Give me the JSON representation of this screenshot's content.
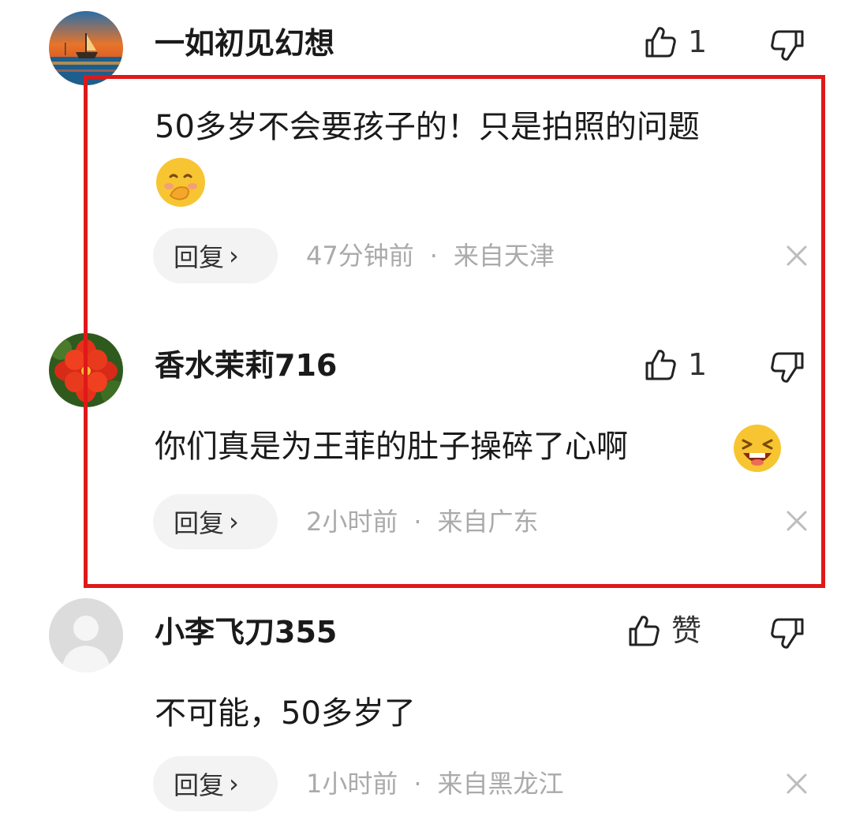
{
  "comments": [
    {
      "username": "一如初见幻想",
      "like_count": "1",
      "text": "50多岁不会要孩子的！只是拍照的问题",
      "reply_label": "回复",
      "time": "47分钟前",
      "location": "来自天津",
      "avatar_icon": "sunset-boat-painting-avatar"
    },
    {
      "username": "香水茉莉716",
      "like_count": "1",
      "text": "你们真是为王菲的肚子操碎了心啊",
      "reply_label": "回复",
      "time": "2小时前",
      "location": "来自广东",
      "avatar_icon": "red-flower-avatar"
    },
    {
      "username": "小李飞刀355",
      "like_count": "赞",
      "text": "不可能，50多岁了",
      "reply_label": "回复",
      "time": "1小时前",
      "location": "来自黑龙江",
      "avatar_icon": "default-person-avatar"
    }
  ],
  "separator": "·",
  "colors": {
    "highlight_border": "#e01818",
    "reply_pill_bg": "#f3f3f3",
    "meta_text": "#aaaaaa"
  }
}
